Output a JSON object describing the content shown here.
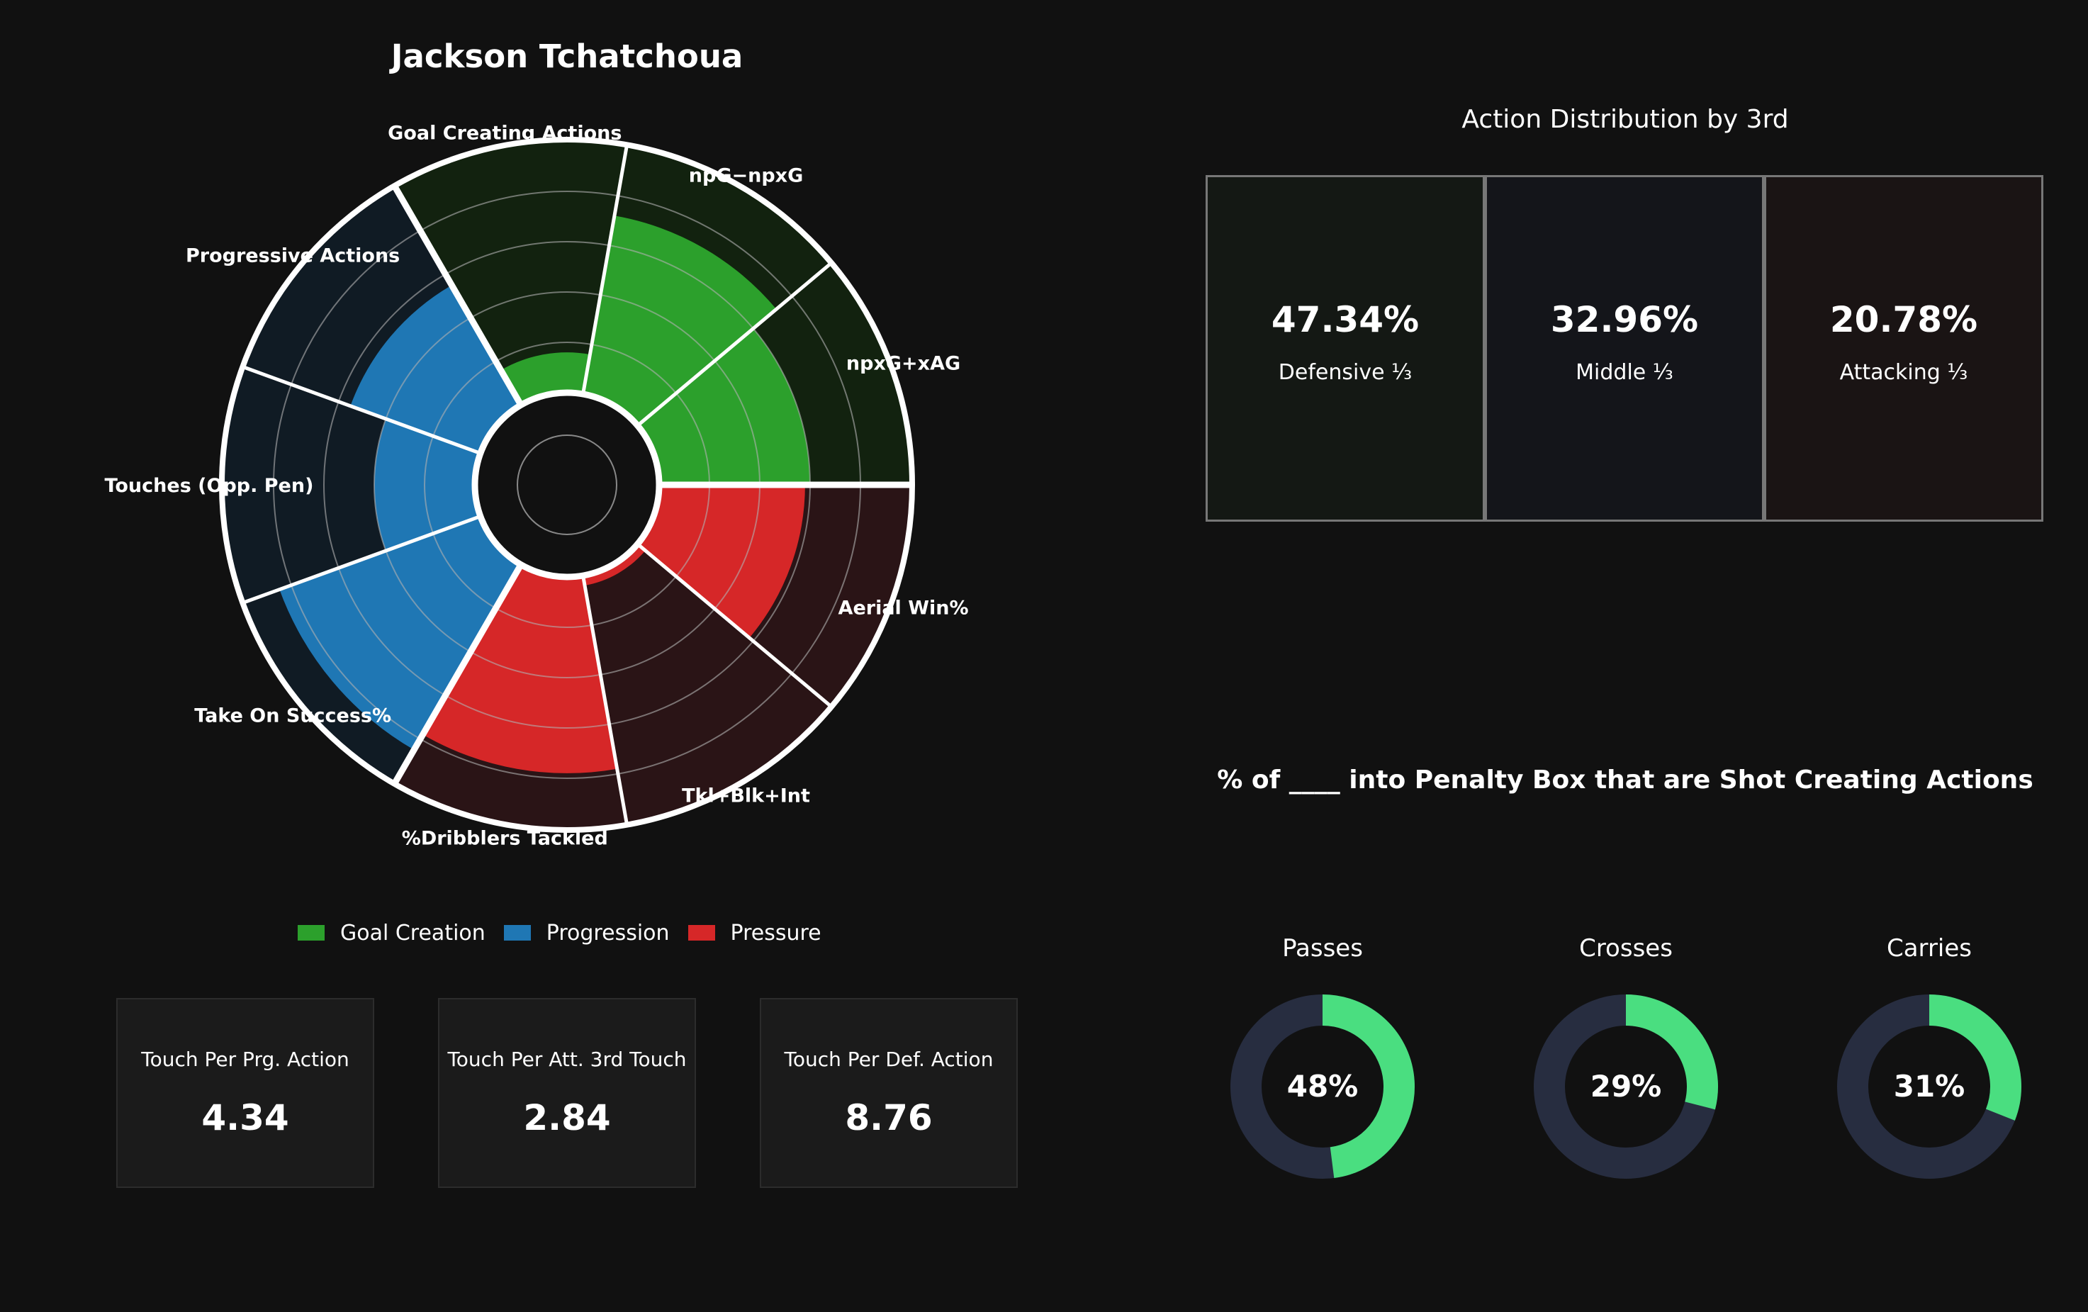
{
  "chart_data": [
    {
      "type": "polar-bar",
      "title": "Jackson Tchatchoua",
      "categories": [
        "npxG+xAG",
        "npG−npxG",
        "Goal Creating Actions",
        "Progressive Actions",
        "Touches (Opp. Pen)",
        "Take On Success%",
        "%Dribblers Tackled",
        "Tkl+Blk+Int",
        "Aerial Win%"
      ],
      "groups": [
        "Goal Creation",
        "Goal Creation",
        "Goal Creation",
        "Progression",
        "Progression",
        "Progression",
        "Pressure",
        "Pressure",
        "Pressure"
      ],
      "values": [
        60,
        72,
        16,
        55,
        40,
        85,
        78,
        4,
        58
      ],
      "ylim": [
        0,
        100
      ],
      "legend": [
        {
          "name": "Goal Creation",
          "color": "#2ca02c",
          "bg": "#12220f"
        },
        {
          "name": "Progression",
          "color": "#1f77b4",
          "bg": "#101b24"
        },
        {
          "name": "Pressure",
          "color": "#d62728",
          "bg": "#2a1416"
        }
      ]
    },
    {
      "type": "table",
      "title": "Action Distribution by 3rd",
      "cells": [
        {
          "value": "47.34%",
          "label": "Defensive ⅓",
          "bg": "#141814"
        },
        {
          "value": "32.96%",
          "label": "Middle ⅓",
          "bg": "#14151a"
        },
        {
          "value": "20.78%",
          "label": "Attacking ⅓",
          "bg": "#1a1414"
        }
      ]
    },
    {
      "type": "pie",
      "title": "% of ____ into Penalty Box that are Shot Creating Actions",
      "items": [
        {
          "label": "Passes",
          "value": 48,
          "text": "48%"
        },
        {
          "label": "Crosses",
          "value": 29,
          "text": "29%"
        },
        {
          "label": "Carries",
          "value": 31,
          "text": "31%"
        }
      ],
      "colors": {
        "fill": "#4ade80",
        "track": "#272d40"
      }
    }
  ],
  "stats": [
    {
      "label": "Touch Per Prg. Action",
      "value": "4.34"
    },
    {
      "label": "Touch Per Att. 3rd Touch",
      "value": "2.84"
    },
    {
      "label": "Touch Per Def. Action",
      "value": "8.76"
    }
  ]
}
